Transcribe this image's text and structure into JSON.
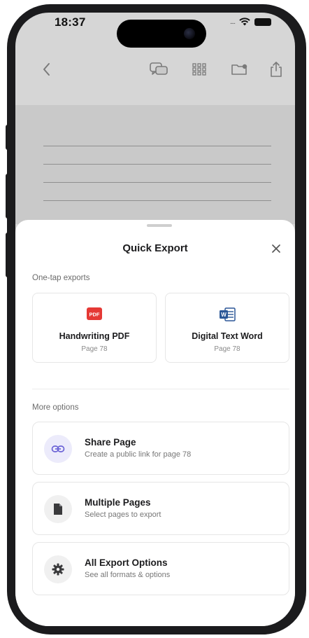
{
  "status_bar": {
    "time": "18:37",
    "signal": "....",
    "wifi_icon": "wifi-icon",
    "battery_icon": "battery-icon"
  },
  "toolbar": {
    "back_icon": "chevron-left-icon",
    "icons": [
      "chat-bubbles-icon",
      "grid-icon",
      "folder-icon",
      "share-icon"
    ]
  },
  "sheet": {
    "title": "Quick Export",
    "close_icon": "close-icon",
    "one_tap_label": "One-tap exports",
    "quick_exports": [
      {
        "badge": "PDF",
        "title": "Handwriting PDF",
        "subtitle": "Page 78",
        "icon": "pdf-icon",
        "color": "#e53935"
      },
      {
        "badge": "W",
        "title": "Digital Text Word",
        "subtitle": "Page 78",
        "icon": "word-icon",
        "color": "#2b5797"
      }
    ],
    "more_label": "More options",
    "options": [
      {
        "title": "Share Page",
        "subtitle": "Create a public link for page 78",
        "icon": "link-icon"
      },
      {
        "title": "Multiple Pages",
        "subtitle": "Select pages to export",
        "icon": "document-icon"
      },
      {
        "title": "All Export Options",
        "subtitle": "See all formats & options",
        "icon": "gear-icon"
      }
    ]
  },
  "colors": {
    "accent": "#6b63d6",
    "link_icon_bg": "#ecebfb",
    "neutral_icon_bg": "#f0f0f0",
    "dimmed_background": "#d6d6d6"
  }
}
